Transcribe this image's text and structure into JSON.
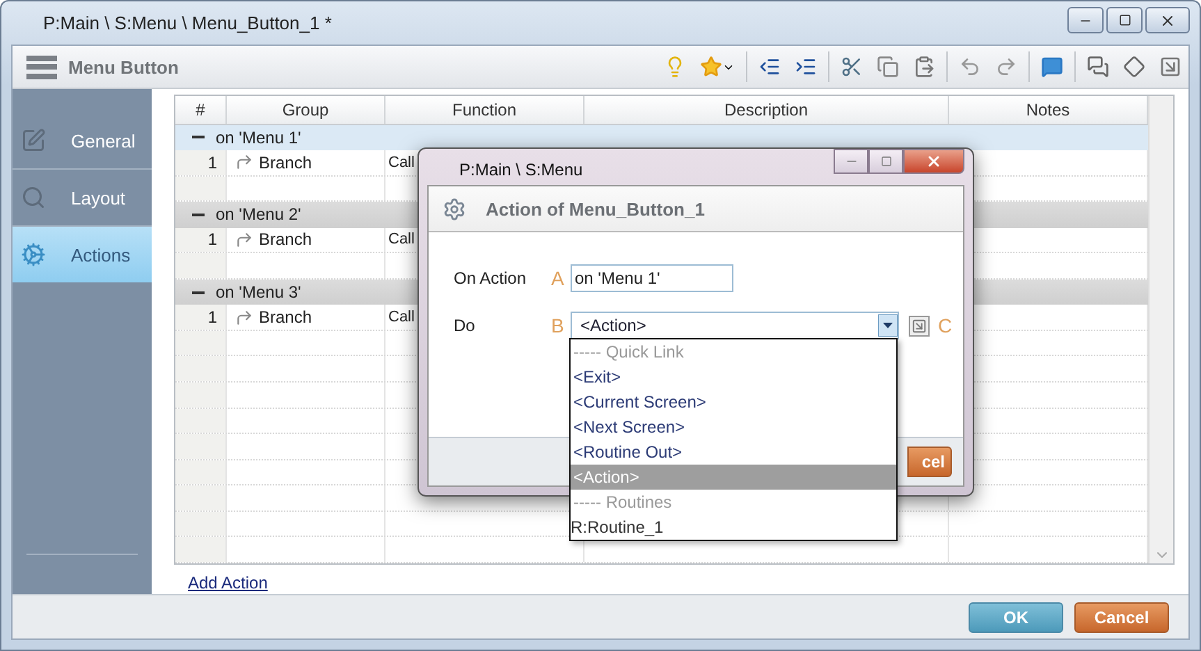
{
  "window": {
    "title": "P:Main \\ S:Menu \\ Menu_Button_1 *"
  },
  "toolbar": {
    "title": "Menu Button"
  },
  "sidebar": {
    "items": [
      {
        "label": "General",
        "selected": false
      },
      {
        "label": "Layout",
        "selected": false
      },
      {
        "label": "Actions",
        "selected": true
      }
    ]
  },
  "table": {
    "columns": [
      "#",
      "Group",
      "Function",
      "Description",
      "Notes"
    ],
    "groups": [
      {
        "label": "on 'Menu 1'",
        "expanded": true,
        "selected": true,
        "rows": [
          {
            "number": "1",
            "group": "Branch",
            "function": "Call"
          }
        ]
      },
      {
        "label": "on 'Menu 2'",
        "expanded": true,
        "selected": false,
        "rows": [
          {
            "number": "1",
            "group": "Branch",
            "function": "Call"
          }
        ]
      },
      {
        "label": "on 'Menu 3'",
        "expanded": true,
        "selected": false,
        "rows": [
          {
            "number": "1",
            "group": "Branch",
            "function": "Call"
          }
        ]
      }
    ]
  },
  "add_action": "Add Action",
  "buttons": [
    {
      "label": "OK",
      "kind": "primary"
    },
    {
      "label": "Cancel",
      "kind": "cancel"
    }
  ],
  "dialog": {
    "title": "P:Main \\ S:Menu",
    "heading": "Action of Menu_Button_1",
    "fields": [
      {
        "label": "On Action",
        "marker": "A",
        "kind": "text",
        "value": "on 'Menu 1'"
      },
      {
        "label": "Do",
        "marker": "B",
        "kind": "select",
        "value": "<Action>",
        "button_marker": "C"
      }
    ],
    "cancel_visible_text": "cel",
    "dropdown": [
      {
        "label": "----- Quick Link",
        "kind": "header",
        "selected": false
      },
      {
        "label": "<Exit>",
        "kind": "option",
        "selected": false
      },
      {
        "label": "<Current Screen>",
        "kind": "option",
        "selected": false
      },
      {
        "label": "<Next Screen>",
        "kind": "option",
        "selected": false
      },
      {
        "label": "<Routine Out>",
        "kind": "option",
        "selected": false
      },
      {
        "label": "<Action>",
        "kind": "option",
        "selected": true
      },
      {
        "label": "----- Routines",
        "kind": "header",
        "selected": false
      },
      {
        "label": "R:Routine_1",
        "kind": "routine",
        "selected": false
      }
    ]
  }
}
